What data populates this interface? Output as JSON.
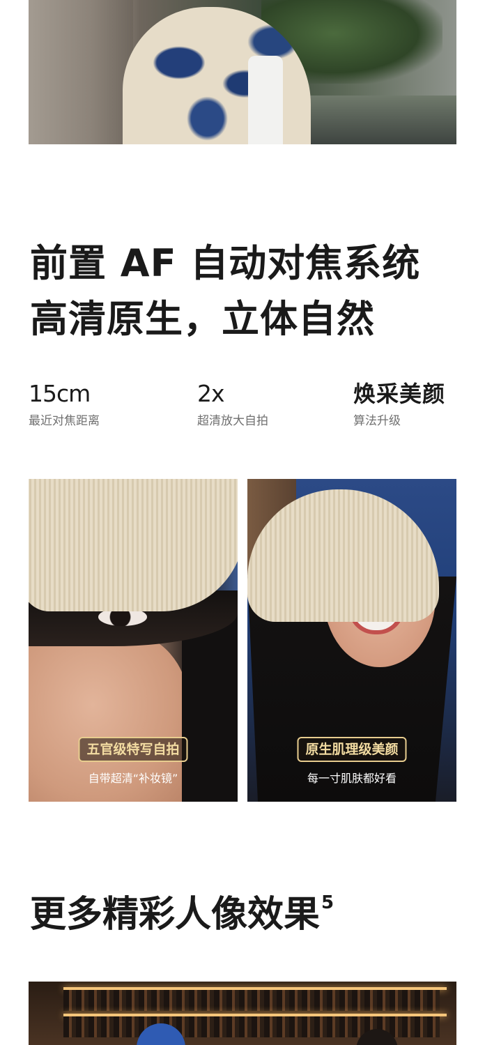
{
  "headline": {
    "line1": "前置 AF 自动对焦系统",
    "line2": "高清原生，立体自然"
  },
  "specs": [
    {
      "value": "15cm",
      "label": "最近对焦距离"
    },
    {
      "value": "2x",
      "label": "超清放大自拍"
    },
    {
      "value": "焕采美颜",
      "label": "算法升级"
    }
  ],
  "portraits": [
    {
      "badge": "五官级特写自拍",
      "caption": "自带超清“补妆镜”"
    },
    {
      "badge": "原生肌理级美颜",
      "caption": "每一寸肌肤都好看"
    }
  ],
  "section2": {
    "title": "更多精彩人像效果",
    "footnote": "5"
  },
  "colors": {
    "badge_border": "#e8cd8f",
    "badge_text": "#f3dca2",
    "headline": "#1a1a1a",
    "label_gray": "#707070"
  }
}
